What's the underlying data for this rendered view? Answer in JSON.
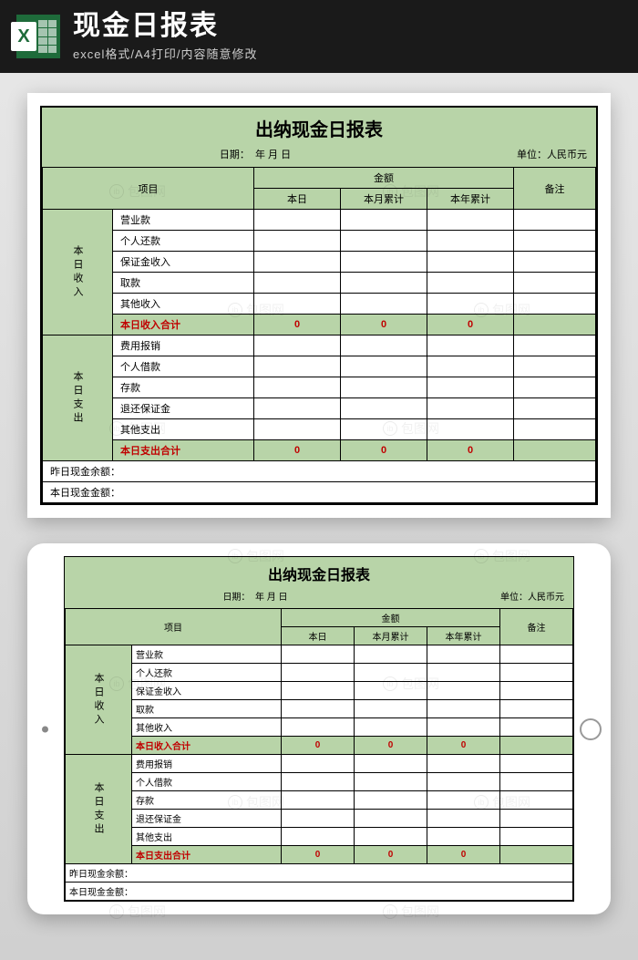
{
  "header": {
    "title": "现金日报表",
    "subtitle": "excel格式/A4打印/内容随意修改"
  },
  "sheet": {
    "title": "出纳现金日报表",
    "date_label": "日期：",
    "date_value": "年  月  日",
    "unit_label": "单位：人民币元",
    "headers": {
      "project": "项目",
      "amount": "金额",
      "today": "本日",
      "month_total": "本月累计",
      "year_total": "本年累计",
      "remark": "备注"
    },
    "income_section": {
      "label": "本日收入",
      "rows": [
        "营业款",
        "个人还款",
        "保证金收入",
        "取款",
        "其他收入"
      ],
      "sum_label": "本日收入合计",
      "sum_values": [
        "0",
        "0",
        "0"
      ]
    },
    "expense_section": {
      "label": "本日支出",
      "rows": [
        "费用报销",
        "个人借款",
        "存款",
        "退还保证金",
        "其他支出"
      ],
      "sum_label": "本日支出合计",
      "sum_values": [
        "0",
        "0",
        "0"
      ]
    },
    "footer": {
      "yesterday": "昨日现金余额：",
      "today": "本日现金金额："
    }
  },
  "watermark": "包图网"
}
